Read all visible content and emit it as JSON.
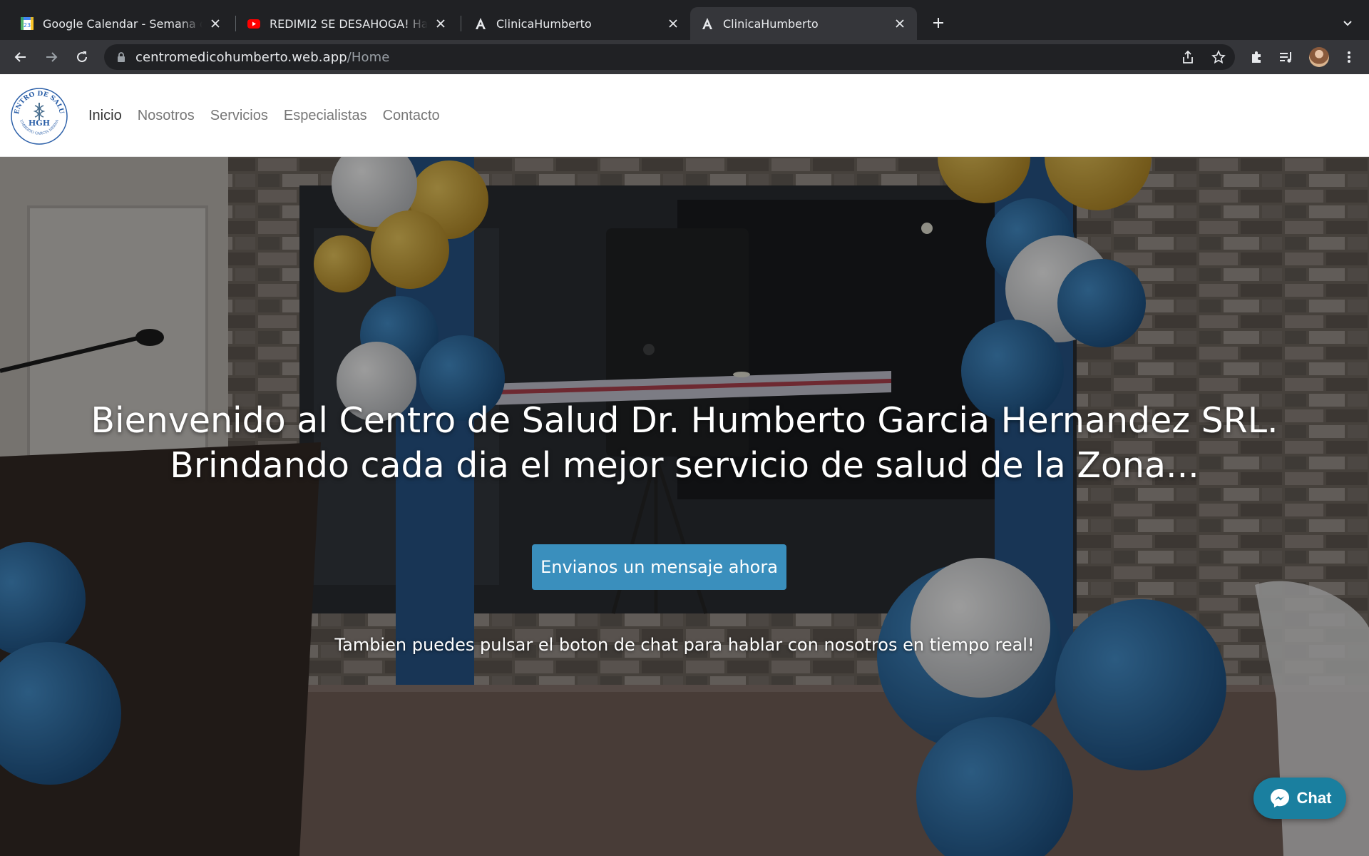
{
  "browser": {
    "tabs": [
      {
        "title": "Google Calendar - Semana del",
        "favicon": "google-calendar-icon",
        "favicon_text": "23"
      },
      {
        "title": "REDIMI2 SE DESAHOGA! Habla",
        "favicon": "youtube-icon"
      },
      {
        "title": "ClinicaHumberto",
        "favicon": "angular-icon"
      },
      {
        "title": "ClinicaHumberto",
        "favicon": "angular-icon",
        "active": true
      }
    ],
    "url_host": "centromedicohumberto.web.app",
    "url_path": "/Home"
  },
  "site": {
    "logo": {
      "ring_text": "CENTRO DE SALUD",
      "initials": "HGH",
      "bottom_text": "DR. HUMBERTO GARCIA HERNANDEZ"
    },
    "nav": [
      {
        "label": "Inicio",
        "active": true
      },
      {
        "label": "Nosotros"
      },
      {
        "label": "Servicios"
      },
      {
        "label": "Especialistas"
      },
      {
        "label": "Contacto"
      }
    ]
  },
  "hero": {
    "title_line1": "Bienvenido al Centro de Salud Dr. Humberto Garcia Hernandez SRL.",
    "title_line2": "Brindando cada dia el mejor servicio de salud de la Zona...",
    "cta_label": "Envianos un mensaje ahora",
    "subtitle": "Tambien puedes pulsar el boton de chat para hablar con nosotros en tiempo real!"
  },
  "chat_button": {
    "label": "Chat",
    "icon": "messenger-icon"
  },
  "colors": {
    "accent": "#3a8fbd",
    "chat": "#1a7f9f",
    "balloon_blue": "#1f6fb0",
    "balloon_yellow": "#e0b53a"
  }
}
